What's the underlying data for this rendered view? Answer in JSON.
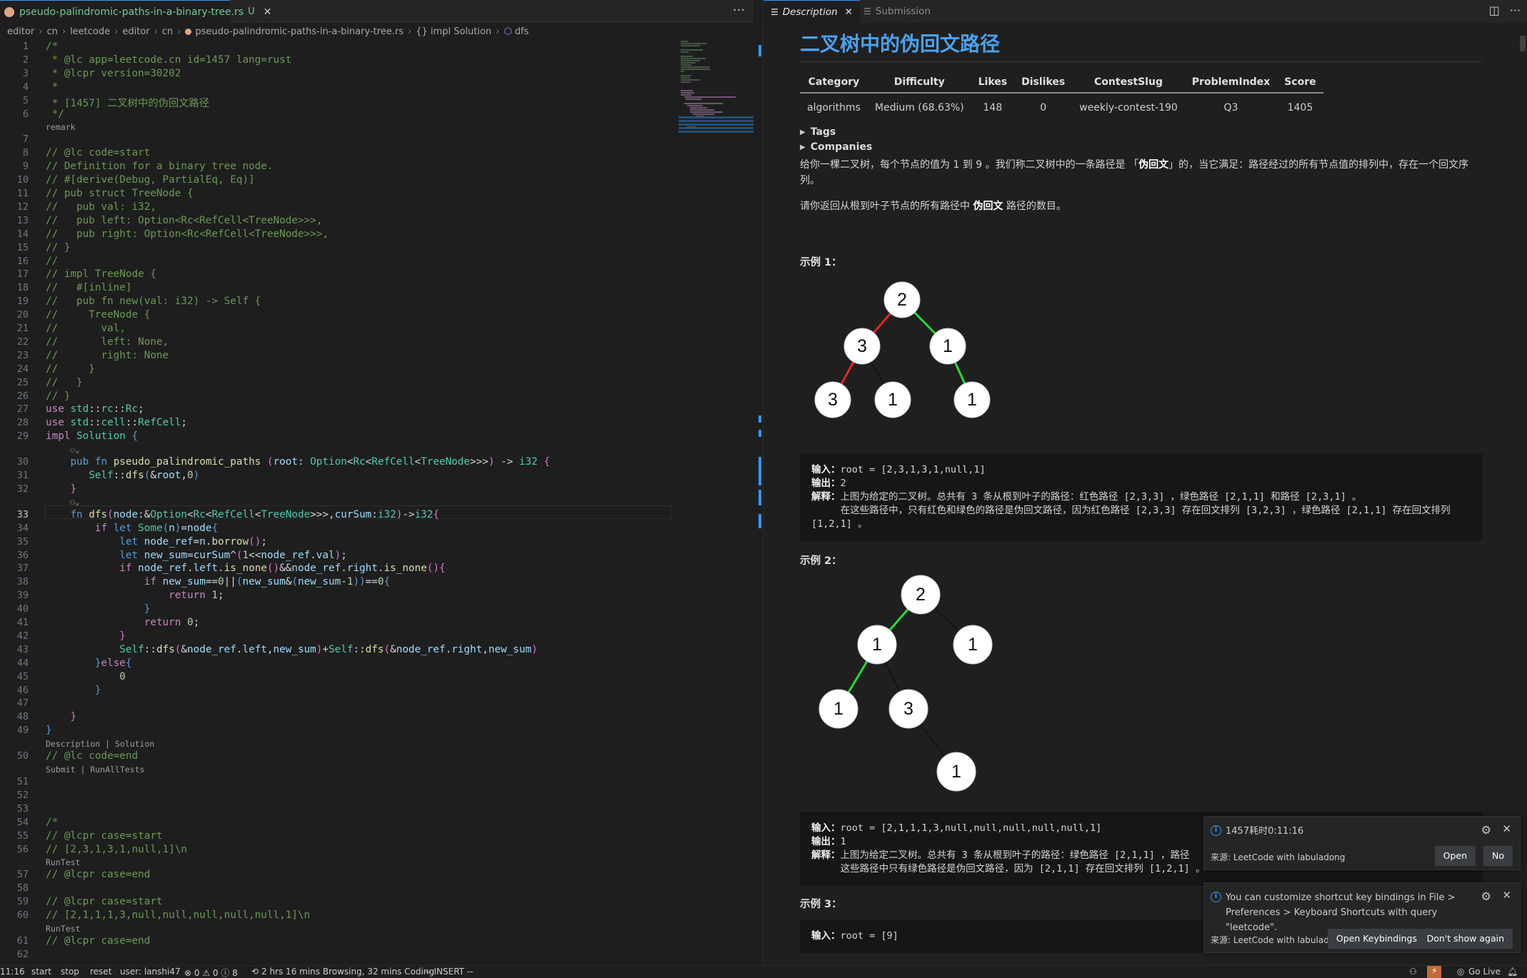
{
  "editor": {
    "tab": {
      "filename": "pseudo-palindromic-paths-in-a-binary-tree.rs",
      "status": "U",
      "close": "✕"
    },
    "more": "···",
    "breadcrumb": [
      "editor",
      "cn",
      "leetcode",
      "editor",
      "cn",
      "pseudo-palindromic-paths-in-a-binary-tree.rs",
      "{} impl Solution",
      "dfs"
    ],
    "current_line": "33",
    "lenses": {
      "remark": "remark",
      "desc_solution": "Description | Solution",
      "submit_runall": "Submit | RunAllTests",
      "runtest": "RunTest"
    }
  },
  "code_lines": [
    {
      "n": "1",
      "html": "<span class='c'>/*</span>"
    },
    {
      "n": "2",
      "html": "<span class='c'> * @lc app=leetcode.cn id=1457 lang=rust</span>"
    },
    {
      "n": "3",
      "html": "<span class='c'> * @lcpr version=30202</span>"
    },
    {
      "n": "4",
      "html": "<span class='c'> *</span>"
    },
    {
      "n": "5",
      "html": "<span class='c'> * [1457] 二叉树中的伪回文路径</span>"
    },
    {
      "n": "6",
      "html": "<span class='c'> */</span>"
    },
    {
      "n": "7",
      "html": ""
    },
    {
      "n": "8",
      "html": "<span class='c'>// @lc code=start</span>"
    },
    {
      "n": "9",
      "html": "<span class='c'>// Definition for a binary tree node.</span>"
    },
    {
      "n": "10",
      "html": "<span class='c'>// #[derive(Debug, PartialEq, Eq)]</span>"
    },
    {
      "n": "11",
      "html": "<span class='c'>// pub struct TreeNode {</span>"
    },
    {
      "n": "12",
      "html": "<span class='c'>//   pub val: i32,</span>"
    },
    {
      "n": "13",
      "html": "<span class='c'>//   pub left: Option&lt;Rc&lt;RefCell&lt;TreeNode&gt;&gt;&gt;,</span>"
    },
    {
      "n": "14",
      "html": "<span class='c'>//   pub right: Option&lt;Rc&lt;RefCell&lt;TreeNode&gt;&gt;&gt;,</span>"
    },
    {
      "n": "15",
      "html": "<span class='c'>// }</span>"
    },
    {
      "n": "16",
      "html": "<span class='c'>//</span>"
    },
    {
      "n": "17",
      "html": "<span class='c'>// impl TreeNode {</span>"
    },
    {
      "n": "18",
      "html": "<span class='c'>//   #[inline]</span>"
    },
    {
      "n": "19",
      "html": "<span class='c'>//   pub fn new(val: i32) -&gt; Self {</span>"
    },
    {
      "n": "20",
      "html": "<span class='c'>//     TreeNode {</span>"
    },
    {
      "n": "21",
      "html": "<span class='c'>//       val,</span>"
    },
    {
      "n": "22",
      "html": "<span class='c'>//       left: None,</span>"
    },
    {
      "n": "23",
      "html": "<span class='c'>//       right: None</span>"
    },
    {
      "n": "24",
      "html": "<span class='c'>//     }</span>"
    },
    {
      "n": "25",
      "html": "<span class='c'>//   }</span>"
    },
    {
      "n": "26",
      "html": "<span class='c'>// }</span>"
    },
    {
      "n": "27",
      "html": "<span class='k'>use</span> <span class='t'>std</span>::<span class='t'>rc</span>::<span class='t'>Rc</span>;"
    },
    {
      "n": "28",
      "html": "<span class='k'>use</span> <span class='t'>std</span>::<span class='t'>cell</span>::<span class='t'>RefCell</span>;"
    },
    {
      "n": "29",
      "html": "<span class='k'>impl</span> <span class='t'>Solution</span> <span class='kb'>{</span>"
    },
    {
      "n": "30",
      "html": "    <span class='kb'>pub</span> <span class='kb'>fn</span> <span class='f'>pseudo_palindromic_paths</span> <span class='p'>(</span><span class='v'>root</span>: <span class='t'>Option</span>&lt;<span class='t'>Rc</span>&lt;<span class='t'>RefCell</span>&lt;<span class='t'>TreeNode</span>&gt;&gt;&gt;<span class='p'>)</span> -&gt; <span class='t'>i32</span> <span class='p'>{</span>"
    },
    {
      "n": "31",
      "html": "       <span class='t'>Self</span>::<span class='f'>dfs</span><span class='kb'>(</span>&amp;<span class='v'>root</span>,<span class='n'>0</span><span class='kb'>)</span>"
    },
    {
      "n": "32",
      "html": "    <span class='p'>}</span>"
    },
    {
      "n": "33",
      "html": "    <span class='kb'>fn</span> <span class='f'>dfs</span><span class='p'>(</span><span class='v'>node</span>:&amp;<span class='t'>Option</span>&lt;<span class='t'>Rc</span>&lt;<span class='t'>RefCell</span>&lt;<span class='t'>TreeNode</span>&gt;&gt;&gt;,<span class='v'>curSum</span>:<span class='t'>i32</span><span class='p'>)</span>-&gt;<span class='t'>i32</span><span class='p'>{</span>"
    },
    {
      "n": "34",
      "html": "        <span class='k'>if</span> <span class='kb'>let</span> <span class='t'>Some</span><span class='kb'>(</span><span class='v'>n</span><span class='kb'>)</span>=<span class='v'>node</span><span class='kb'>{</span>"
    },
    {
      "n": "35",
      "html": "            <span class='kb'>let</span> <span class='v'>node_ref</span>=<span class='v'>n</span>.<span class='f'>borrow</span><span class='p'>()</span>;"
    },
    {
      "n": "36",
      "html": "            <span class='kb'>let</span> <span class='v'>new_sum</span>=<span class='v'>curSum</span>^<span class='p'>(</span><span class='n'>1</span>&lt;&lt;<span class='v'>node_ref</span>.<span class='v'>val</span><span class='p'>)</span>;"
    },
    {
      "n": "37",
      "html": "            <span class='k'>if</span> <span class='v'>node_ref</span>.<span class='v'>left</span>.<span class='f'>is_none</span><span class='p'>()</span>&amp;&amp;<span class='v'>node_ref</span>.<span class='v'>right</span>.<span class='f'>is_none</span><span class='p'>()</span><span class='p'>{</span>"
    },
    {
      "n": "38",
      "html": "                <span class='k'>if</span> <span class='v'>new_sum</span>==<span class='n'>0</span>||<span class='kb'>(</span><span class='v'>new_sum</span>&amp;<span class='kb'>(</span><span class='v'>new_sum</span>-<span class='n'>1</span><span class='kb'>))</span>==<span class='n'>0</span><span class='kb'>{</span>"
    },
    {
      "n": "39",
      "html": "                    <span class='k'>return</span> <span class='n'>1</span>;"
    },
    {
      "n": "40",
      "html": "                <span class='kb'>}</span>"
    },
    {
      "n": "41",
      "html": "                <span class='k'>return</span> <span class='n'>0</span>;"
    },
    {
      "n": "42",
      "html": "            <span class='p'>}</span>"
    },
    {
      "n": "43",
      "html": "            <span class='t'>Self</span>::<span class='f'>dfs</span><span class='p'>(</span>&amp;<span class='v'>node_ref</span>.<span class='v'>left</span>,<span class='v'>new_sum</span><span class='p'>)</span>+<span class='t'>Self</span>::<span class='f'>dfs</span><span class='p'>(</span>&amp;<span class='v'>node_ref</span>.<span class='v'>right</span>,<span class='v'>new_sum</span><span class='p'>)</span>"
    },
    {
      "n": "44",
      "html": "        <span class='kb'>}</span><span class='k'>else</span><span class='kb'>{</span>"
    },
    {
      "n": "45",
      "html": "            <span class='n'>0</span>"
    },
    {
      "n": "46",
      "html": "        <span class='kb'>}</span>"
    },
    {
      "n": "47",
      "html": ""
    },
    {
      "n": "48",
      "html": "    <span class='p'>}</span>"
    },
    {
      "n": "49",
      "html": "<span class='kb'>}</span>"
    },
    {
      "n": "50",
      "html": "<span class='c'>// @lc code=end</span>"
    },
    {
      "n": "51",
      "html": ""
    },
    {
      "n": "52",
      "html": ""
    },
    {
      "n": "53",
      "html": ""
    },
    {
      "n": "54",
      "html": "<span class='c'>/*</span>"
    },
    {
      "n": "55",
      "html": "<span class='c'>// @lcpr case=start</span>"
    },
    {
      "n": "56",
      "html": "<span class='c'>// [2,3,1,3,1,null,1]\\n</span>"
    },
    {
      "n": "57",
      "html": "<span class='c'>// @lcpr case=end</span>"
    },
    {
      "n": "58",
      "html": ""
    },
    {
      "n": "59",
      "html": "<span class='c'>// @lcpr case=start</span>"
    },
    {
      "n": "60",
      "html": "<span class='c'>// [2,1,1,1,3,null,null,null,null,null,1]\\n</span>"
    },
    {
      "n": "61",
      "html": "<span class='c'>// @lcpr case=end</span>"
    },
    {
      "n": "62",
      "html": ""
    }
  ],
  "panel": {
    "tabs": [
      {
        "label": "Description",
        "active": true
      },
      {
        "label": "Submission",
        "active": false
      }
    ],
    "title": "二叉树中的伪回文路径",
    "table": {
      "headers": [
        "Category",
        "Difficulty",
        "Likes",
        "Dislikes",
        "ContestSlug",
        "ProblemIndex",
        "Score"
      ],
      "row": [
        "algorithms",
        "Medium (68.63%)",
        "148",
        "0",
        "weekly-contest-190",
        "Q3",
        "1405"
      ]
    },
    "tags": "Tags",
    "companies": "Companies",
    "desc1_a": "给你一棵二叉树，每个节点的值为 1 到 9 。我们称二叉树中的一条路径是 「",
    "desc1_b": "伪回文",
    "desc1_c": "」的，当它满足：路径经过的所有节点值的排列中，存在一个回文序列。",
    "desc2_a": "请你返回从根到叶子节点的所有路径中 ",
    "desc2_b": "伪回文",
    "desc2_c": " 路径的数目。",
    "ex1_title": "示例 1：",
    "ex1": {
      "in_label": "输入：",
      "in": "root = [2,3,1,3,1,null,1]",
      "out_label": "输出：",
      "out": "2",
      "exp_label": "解释：",
      "exp": "上图为给定的二叉树。总共有 3 条从根到叶子的路径：红色路径 [2,3,3] ，绿色路径 [2,1,1] 和路径 [2,3,1] 。\n     在这些路径中，只有红色和绿色的路径是伪回文路径，因为红色路径 [2,3,3] 存在回文排列 [3,2,3] ，绿色路径 [2,1,1] 存在回文排列 [1,2,1] 。"
    },
    "ex2_title": "示例 2：",
    "ex2": {
      "in_label": "输入：",
      "in": "root = [2,1,1,1,3,null,null,null,null,null,1]",
      "out_label": "输出：",
      "out": "1",
      "exp_label": "解释：",
      "exp": "上图为给定二叉树。总共有 3 条从根到叶子的路径：绿色路径 [2,1,1] ，路径\n     这些路径中只有绿色路径是伪回文路径，因为 [2,1,1] 存在回文排列 [1,2,1] 。"
    },
    "ex3_title": "示例 3：",
    "ex3": {
      "in_label": "输入：",
      "in": "root = [9]"
    },
    "tree1": {
      "nodes": [
        "2",
        "3",
        "1",
        "3",
        "1",
        "1"
      ],
      "colors": {
        "red": "#e52222",
        "green": "#22dd33",
        "black": "#111111"
      }
    },
    "tree2": {
      "nodes": [
        "2",
        "1",
        "1",
        "1",
        "3",
        "1"
      ]
    }
  },
  "notifications": [
    {
      "message": "1457耗时0:11:16",
      "source": "来源: LeetCode with labuladong",
      "buttons": [
        "Open",
        "No"
      ]
    },
    {
      "message": "You can customize shortcut key bindings in File > Preferences > Keyboard Shortcuts with query \"leetcode\".",
      "source": "来源: LeetCode with labuladong",
      "buttons": [
        "Open Keybindings",
        "Don't show again"
      ]
    }
  ],
  "status": {
    "position": "11:16",
    "start": "start",
    "stop": "stop",
    "reset": "reset",
    "user": "user: lanshi47",
    "problems": "⊗ 0 ⚠ 0 ⓘ 8",
    "time": "2 hrs 16 mins Browsing, 32 mins Coding",
    "mode": "-- INSERT --",
    "golive": "Go Live"
  },
  "colors": {
    "accent": "#3794ff",
    "title": "#4aa1ee",
    "status_badge": "#c26b35"
  }
}
